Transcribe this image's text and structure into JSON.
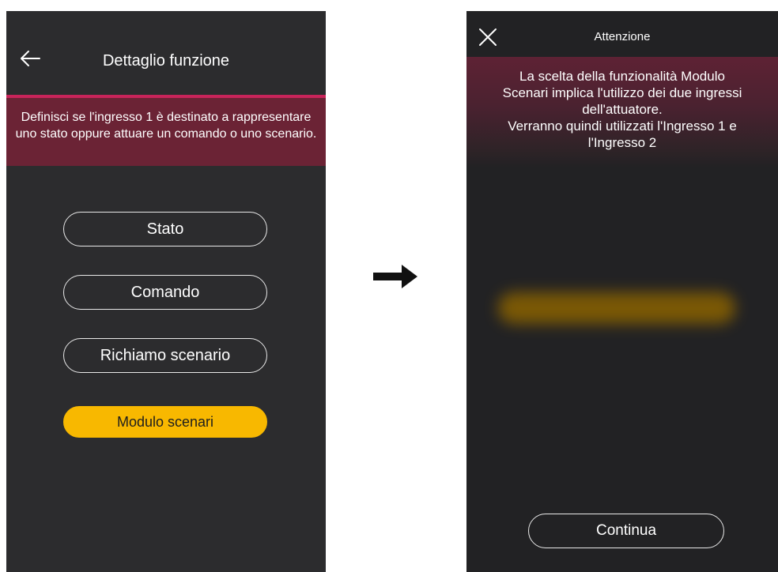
{
  "left_screen": {
    "header": {
      "title": "Dettaglio funzione",
      "back_icon": "arrow-left-icon"
    },
    "info_text": "Definisci se l'ingresso 1 è destinato a rappresentare uno stato oppure attuare un comando o uno scenario.",
    "options": [
      {
        "label": "Stato",
        "selected": false
      },
      {
        "label": "Comando",
        "selected": false
      },
      {
        "label": "Richiamo scenario",
        "selected": false
      },
      {
        "label": "Modulo scenari",
        "selected": true
      }
    ]
  },
  "transition_icon": "arrow-right-icon",
  "right_screen": {
    "header": {
      "title": "Attenzione",
      "close_icon": "close-icon"
    },
    "warning_text_lines": [
      "La scelta della funzionalità Modulo",
      "Scenari implica l'utilizzo dei due ingressi",
      "dell'attuatore.",
      "Verranno quindi utilizzati l'Ingresso 1 e",
      "l'Ingresso 2"
    ],
    "continue_label": "Continua"
  },
  "colors": {
    "screen_bg": "#2c2c2e",
    "accent": "#c8245a",
    "banner_bg": "#6b2335",
    "selected_bg": "#f8b800",
    "text": "#ffffff"
  }
}
